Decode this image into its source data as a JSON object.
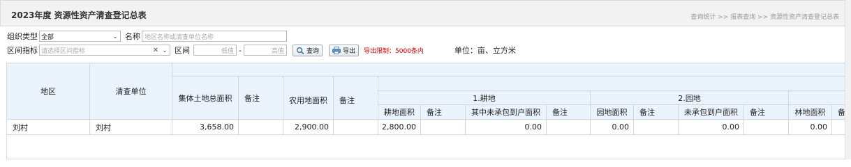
{
  "header": {
    "title": "2023年度 资源性资产清查登记总表",
    "breadcrumb": "查询统计 >> 报表查询 >> 资源性资产清查登记总表"
  },
  "filters": {
    "org_type_label": "组织类型",
    "org_type_value": "全部",
    "name_label": "名称",
    "name_placeholder": "地区名称或清查单位名称",
    "indicator_label": "区间指标",
    "indicator_placeholder": "请选择区间指标",
    "range_label": "区间",
    "low_placeholder": "低值",
    "dash": "-",
    "high_placeholder": "高值",
    "query_button": "查询",
    "export_button": "导出",
    "export_limit": "导出限制：5000条内",
    "unit": "单位：亩、立方米"
  },
  "table": {
    "headers": {
      "region": "地区",
      "unit": "清查单位",
      "total_land": "集体土地总面积",
      "remark": "备注",
      "agri_land": "农用地面积",
      "group_arable": "1.耕地",
      "group_garden": "2.园地",
      "arable_area": "耕地面积",
      "not_contracted": "其中未承包到户面积",
      "garden_area": "园地面积",
      "garden_not_contracted": "未承包到户面积",
      "forest_area": "林地面积",
      "remark_cut": "备"
    },
    "rows": [
      {
        "region": "刘村",
        "unit": "刘村",
        "total_land": "3,658.00",
        "agri_land": "2,900.00",
        "arable_area": "2,800.00",
        "not_contracted": "0.00",
        "garden_area": "0.00",
        "garden_not_contracted": "0.00",
        "forest_area": "0.00"
      }
    ]
  },
  "colors": {
    "header_bg": "#eaf3fb",
    "border": "#cfd9e4",
    "limit_red": "#d60000"
  }
}
